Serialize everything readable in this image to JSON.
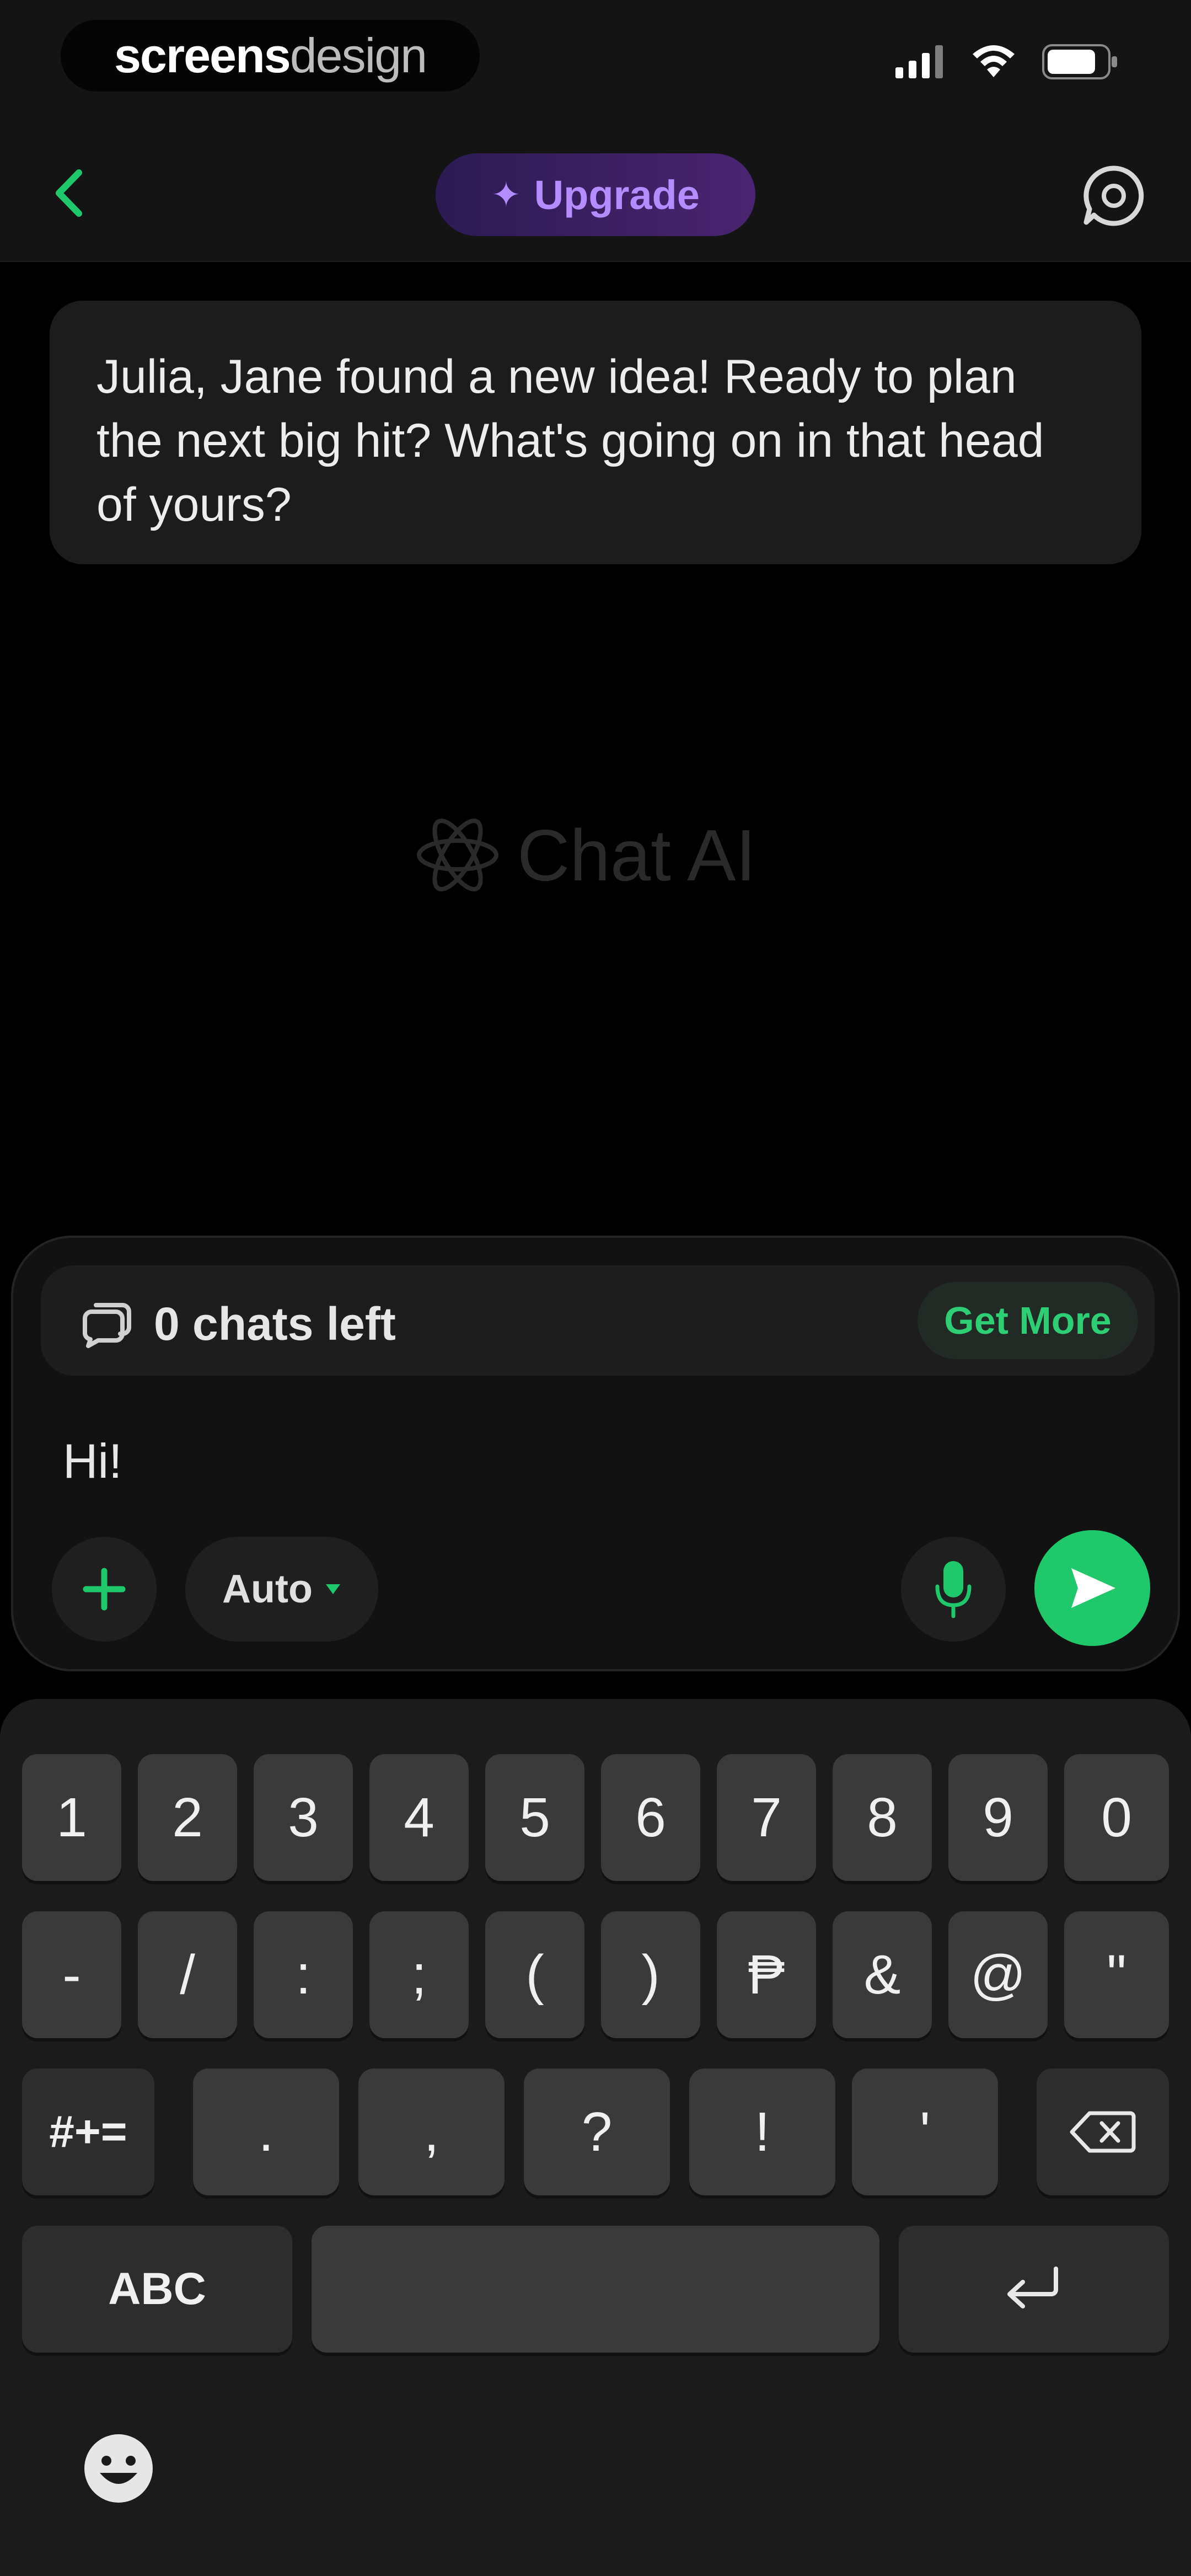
{
  "status_bar": {
    "brand_bold": "screens",
    "brand_light": "design",
    "icons": [
      "signal-icon",
      "wifi-icon",
      "battery-icon"
    ]
  },
  "header": {
    "back_icon": "chevron-left-icon",
    "upgrade_label": "Upgrade",
    "upgrade_icon": "sparkle-icon",
    "history_icon": "chat-bubble-icon"
  },
  "conversation": {
    "ai_message": "Julia, Jane found a new idea! Ready to plan the next big hit? What's going on in that head of yours?"
  },
  "watermark": {
    "label": "Chat AI",
    "icon": "atom-icon"
  },
  "composer": {
    "chats_left_label": "0 chats left",
    "get_more_label": "Get More",
    "input_value": "Hi!",
    "model_label": "Auto",
    "attach_icon": "plus-icon",
    "mic_icon": "microphone-icon",
    "send_icon": "send-icon"
  },
  "keyboard": {
    "row1": [
      "1",
      "2",
      "3",
      "4",
      "5",
      "6",
      "7",
      "8",
      "9",
      "0"
    ],
    "row2": [
      "-",
      "/",
      ":",
      ";",
      "(",
      ")",
      "₱",
      "&",
      "@",
      "\""
    ],
    "row3_left": "#+=",
    "row3": [
      ".",
      ",",
      "?",
      "!",
      "'"
    ],
    "abc_label": "ABC",
    "emoji_icon": "emoji-icon"
  },
  "colors": {
    "accent_green": "#1fc86a",
    "upgrade_purple": "#b48cff",
    "background": "#000000",
    "surface": "#1c1c1c"
  }
}
